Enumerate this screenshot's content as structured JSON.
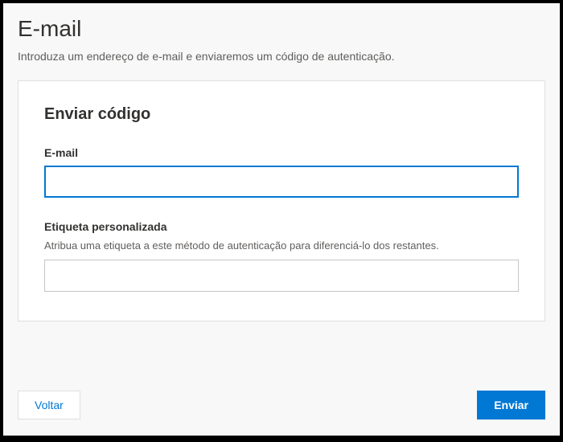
{
  "header": {
    "title": "E-mail",
    "subtitle": "Introduza um endereço de e-mail e enviaremos um código de autenticação."
  },
  "card": {
    "title": "Enviar código",
    "email": {
      "label": "E-mail",
      "value": ""
    },
    "custom_tag": {
      "label": "Etiqueta personalizada",
      "helper": "Atribua uma etiqueta a este método de autenticação para diferenciá-lo dos restantes.",
      "value": ""
    }
  },
  "buttons": {
    "back": "Voltar",
    "send": "Enviar"
  }
}
